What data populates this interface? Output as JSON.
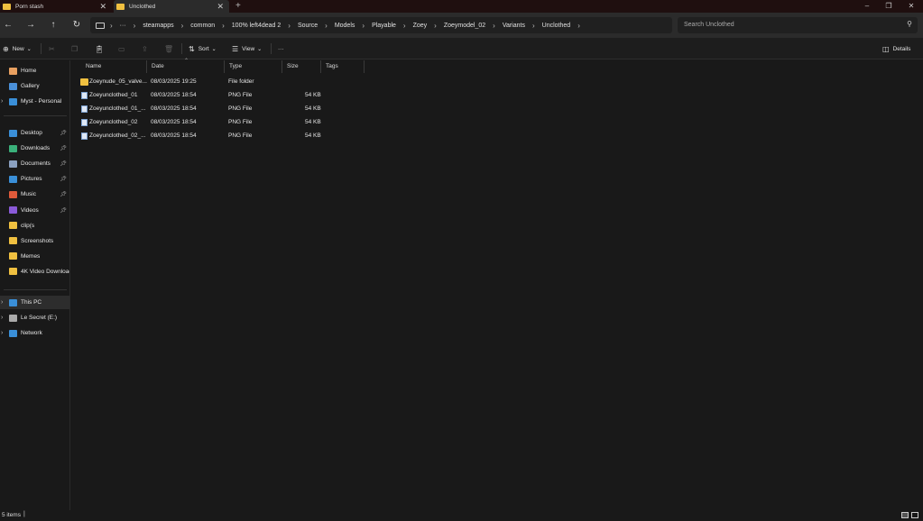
{
  "tabs": [
    {
      "title": "Porn stash",
      "close": "✕"
    },
    {
      "title": "Unclothed",
      "close": "✕"
    }
  ],
  "new_tab": "+",
  "window_controls": {
    "minimize": "–",
    "restore": "❐",
    "close": "✕"
  },
  "nav": {
    "back": "←",
    "forward": "→",
    "up": "↑",
    "refresh": "↻"
  },
  "breadcrumb": {
    "more": "···",
    "items": [
      "steamapps",
      "common",
      "100% left4dead 2",
      "Source",
      "Models",
      "Playable",
      "Zoey",
      "Zoeymodel_02",
      "Variants",
      "Unclothed"
    ],
    "separator": "›"
  },
  "search": {
    "placeholder": "Search Unclothed",
    "icon": "search-icon"
  },
  "toolbar": {
    "new_label": "New",
    "sort_label": "Sort",
    "view_label": "View",
    "more_label": "···",
    "details_label": "Details"
  },
  "sidebar": {
    "top": [
      {
        "label": "Home",
        "icon": "home-icon",
        "color": "#e8a060"
      },
      {
        "label": "Gallery",
        "icon": "gallery-icon",
        "color": "#4a90d9"
      },
      {
        "label": "Myst - Personal",
        "icon": "cloud-icon",
        "color": "#3a8fd8"
      }
    ],
    "quick": [
      {
        "label": "Desktop",
        "icon": "desktop-icon",
        "color": "#3a8fd8",
        "pinned": true
      },
      {
        "label": "Downloads",
        "icon": "download-icon",
        "color": "#3ab07a",
        "pinned": true
      },
      {
        "label": "Documents",
        "icon": "documents-icon",
        "color": "#8aa0c0",
        "pinned": true
      },
      {
        "label": "Pictures",
        "icon": "pictures-icon",
        "color": "#3a8fd8",
        "pinned": true
      },
      {
        "label": "Music",
        "icon": "music-icon",
        "color": "#e05a3a",
        "pinned": true
      },
      {
        "label": "Videos",
        "icon": "videos-icon",
        "color": "#8a5ad8",
        "pinned": true
      },
      {
        "label": "clip(s",
        "icon": "folder-icon",
        "color": "#f0c040",
        "pinned": false
      },
      {
        "label": "Screenshots",
        "icon": "folder-icon",
        "color": "#f0c040",
        "pinned": false
      },
      {
        "label": "Memes",
        "icon": "folder-icon",
        "color": "#f0c040",
        "pinned": false
      },
      {
        "label": "4K Video Downloac",
        "icon": "folder-icon",
        "color": "#f0c040",
        "pinned": false
      }
    ],
    "bottom": [
      {
        "label": "This PC",
        "icon": "pc-icon",
        "color": "#3a8fd8"
      },
      {
        "label": "Le Secret (E:)",
        "icon": "drive-icon",
        "color": "#aaaaaa"
      },
      {
        "label": "Network",
        "icon": "network-icon",
        "color": "#3a8fd8"
      }
    ]
  },
  "columns": [
    "Name",
    "Date",
    "Type",
    "Size",
    "Tags"
  ],
  "files": [
    {
      "name": "Zoeynude_05_valve...",
      "date": "08/03/2025 19:25",
      "type": "File folder",
      "size": "",
      "kind": "folder"
    },
    {
      "name": "Zoeyunclothed_01",
      "date": "08/03/2025 18:54",
      "type": "PNG File",
      "size": "54 KB",
      "kind": "png"
    },
    {
      "name": "Zoeyunclothed_01_...",
      "date": "08/03/2025 18:54",
      "type": "PNG File",
      "size": "54 KB",
      "kind": "png"
    },
    {
      "name": "Zoeyunclothed_02",
      "date": "08/03/2025 18:54",
      "type": "PNG File",
      "size": "54 KB",
      "kind": "png"
    },
    {
      "name": "Zoeyunclothed_02_...",
      "date": "08/03/2025 18:54",
      "type": "PNG File",
      "size": "54 KB",
      "kind": "png"
    }
  ],
  "status": {
    "item_count": "5 items"
  }
}
